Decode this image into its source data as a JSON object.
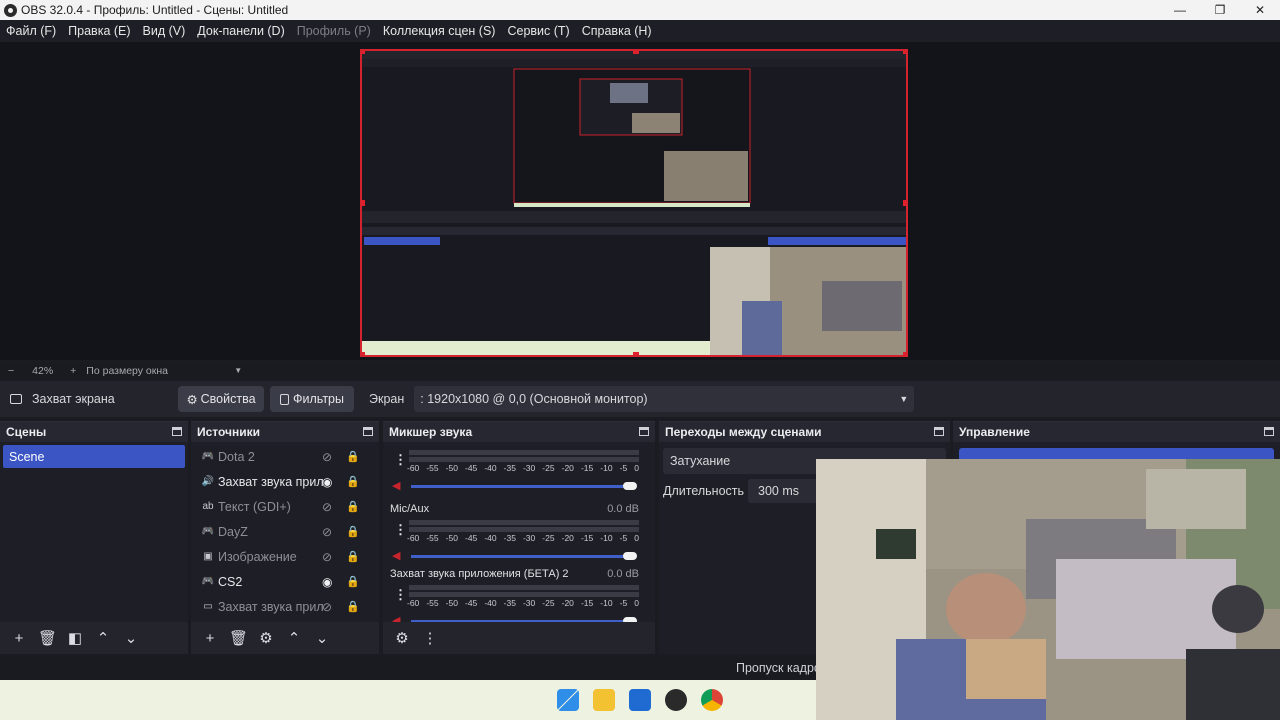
{
  "window": {
    "title": "OBS 32.0.4 - Профиль: Untitled - Сцены: Untitled",
    "minimize": "—",
    "maximize": "❐",
    "close": "✕"
  },
  "menu": [
    "Файл (F)",
    "Правка (E)",
    "Вид (V)",
    "Док-панели (D)",
    "Профиль (P)",
    "Коллекция сцен (S)",
    "Сервис (T)",
    "Справка (H)"
  ],
  "zoom": {
    "minus": "−",
    "value": "42%",
    "plus": "+",
    "fit": "По размеру окна"
  },
  "source_toolbar": {
    "source_name": "Захват экрана",
    "properties": "Свойства",
    "filters": "Фильтры",
    "screen_label": "Экран",
    "screen_value": ": 1920x1080 @ 0,0 (Основной монитор)"
  },
  "scenes": {
    "title": "Сцены",
    "items": [
      "Scene"
    ]
  },
  "sources": {
    "title": "Источники",
    "items": [
      {
        "icon": "gamepad-icon",
        "name": "Dota 2",
        "visible": false
      },
      {
        "icon": "speaker-icon",
        "name": "Захват звука прилс",
        "visible": true
      },
      {
        "icon": "text-icon",
        "name": "Текст (GDI+)",
        "visible": false
      },
      {
        "icon": "gamepad-icon",
        "name": "DayZ",
        "visible": false
      },
      {
        "icon": "image-icon",
        "name": "Изображение",
        "visible": false
      },
      {
        "icon": "gamepad-icon",
        "name": "CS2",
        "visible": true
      },
      {
        "icon": "monitor-icon",
        "name": "Захват звука прилс",
        "visible": false
      }
    ]
  },
  "mixer": {
    "title": "Микшер звука",
    "scale": [
      "-60",
      "-55",
      "-50",
      "-45",
      "-40",
      "-35",
      "-30",
      "-25",
      "-20",
      "-15",
      "-10",
      "-5",
      "0"
    ],
    "channels": [
      {
        "name": "",
        "db": ""
      },
      {
        "name": "Mic/Aux",
        "db": "0.0 dB"
      },
      {
        "name": "Захват звука приложения (БЕТА) 2",
        "db": "0.0 dB"
      }
    ]
  },
  "transitions": {
    "title": "Переходы между сценами",
    "selected": "Затухание",
    "duration_label": "Длительность",
    "duration_value": "300 ms"
  },
  "controls": {
    "title": "Управление"
  },
  "status": {
    "dropped": "Пропуск кадров"
  },
  "colors": {
    "accent": "#3b55c4",
    "selection_red": "#d4232f",
    "background": "#1e1f26"
  }
}
